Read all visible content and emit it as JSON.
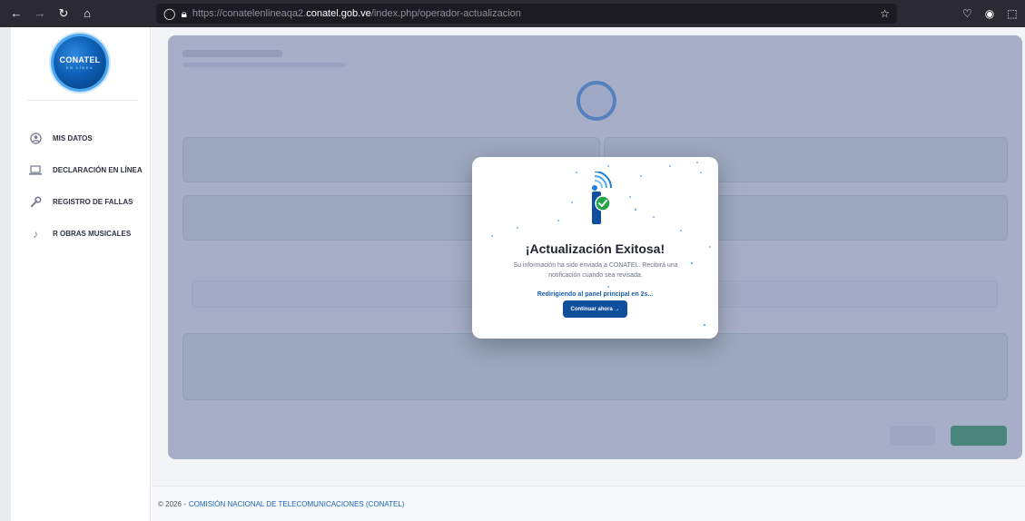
{
  "browser": {
    "url_prefix": "https://conatelenlineaqa2.",
    "url_host": "conatel.gob.ve",
    "url_path": "/index.php/operador-actualizacion"
  },
  "sidebar": {
    "logo_text": "CONATEL",
    "logo_sub": "EN LÍNEA",
    "items": [
      {
        "label": "MIS DATOS",
        "icon": "user-circle-icon"
      },
      {
        "label": "DECLARACIÓN EN LÍNEA",
        "icon": "laptop-icon"
      },
      {
        "label": "REGISTRO DE FALLAS",
        "icon": "wrench-icon"
      },
      {
        "label": "R OBRAS MUSICALES",
        "icon": "music-note-icon"
      }
    ]
  },
  "footer": {
    "copyright": "© 2026 -",
    "org": "COMISIÓN NACIONAL DE TELECOMUNICACIONES (CONATEL)"
  },
  "modal": {
    "title": "¡Actualización Exitosa!",
    "message": "Su información ha sido enviada a CONATEL. Recibirá una notificación cuando sea revisada.",
    "redirect": "Redirigiendo al panel principal en 2s...",
    "button": "Continuar ahora →",
    "accent": "#0f4f9b",
    "success": "#22a447"
  }
}
